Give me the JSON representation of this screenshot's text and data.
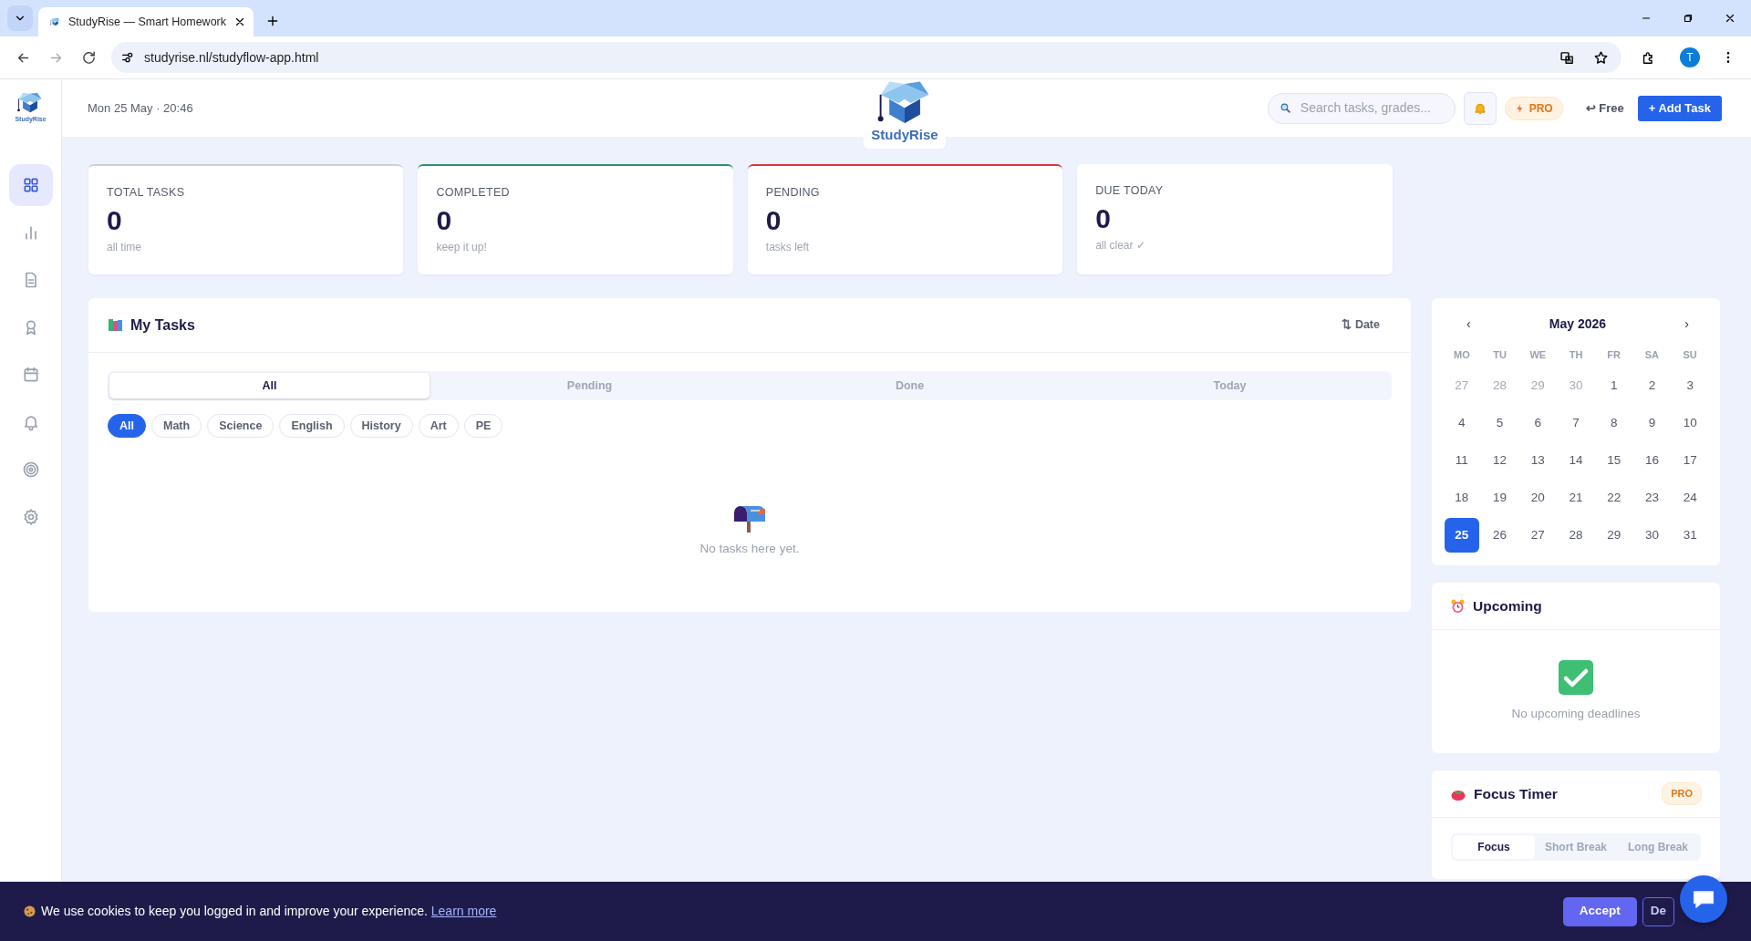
{
  "browser": {
    "tab_title": "StudyRise — Smart Homework",
    "url": "studyrise.nl/studyflow-app.html",
    "profile_initial": "T"
  },
  "sidebar": {
    "logo_text": "StudyRise",
    "items": [
      {
        "kind": "dashboard",
        "selected": true
      },
      {
        "kind": "chart",
        "selected": false
      },
      {
        "kind": "document",
        "selected": false
      },
      {
        "kind": "award",
        "selected": false
      },
      {
        "kind": "calendar",
        "selected": false
      },
      {
        "kind": "bell",
        "selected": false
      },
      {
        "kind": "target",
        "selected": false
      },
      {
        "kind": "settings",
        "selected": false
      }
    ]
  },
  "header": {
    "datetime": "Mon 25 May · 20:46",
    "logo_text": "StudyRise",
    "search": {
      "placeholder": "Search tasks, grades..."
    },
    "pro_badge": "PRO",
    "plan_link": "↩ Free",
    "add_button": "+ Add Task"
  },
  "stats": [
    {
      "label": "TOTAL TASKS",
      "value": "0",
      "caption": "all time",
      "color": "#cbd2dc"
    },
    {
      "label": "COMPLETED",
      "value": "0",
      "caption": "keep it up!",
      "color": "#2f8f6f"
    },
    {
      "label": "PENDING",
      "value": "0",
      "caption": "tasks left",
      "color": "#d9363e"
    },
    {
      "label": "DUE TODAY",
      "value": "0",
      "caption": "all clear ✓"
    }
  ],
  "tasks": {
    "title": "My Tasks",
    "sort": "⇅ Date",
    "tabs": [
      {
        "label": "All",
        "selected": true
      },
      {
        "label": "Pending",
        "selected": false
      },
      {
        "label": "Done",
        "selected": false
      },
      {
        "label": "Today",
        "selected": false
      }
    ],
    "filters": [
      {
        "label": "All",
        "selected": true
      },
      {
        "label": "Math",
        "selected": false
      },
      {
        "label": "Science",
        "selected": false
      },
      {
        "label": "English",
        "selected": false
      },
      {
        "label": "History",
        "selected": false
      },
      {
        "label": "Art",
        "selected": false
      },
      {
        "label": "PE",
        "selected": false
      }
    ],
    "empty_text": "No tasks here yet."
  },
  "calendar": {
    "prev": "‹",
    "month": "May 2026",
    "next": "›",
    "weekdays": [
      "MO",
      "TU",
      "WE",
      "TH",
      "FR",
      "SA",
      "SU"
    ],
    "days": [
      {
        "label": "27",
        "muted": true,
        "selected": false
      },
      {
        "label": "28",
        "muted": true,
        "selected": false
      },
      {
        "label": "29",
        "muted": true,
        "selected": false
      },
      {
        "label": "30",
        "muted": true,
        "selected": false
      },
      {
        "label": "1",
        "muted": false,
        "selected": false
      },
      {
        "label": "2",
        "muted": false,
        "selected": false
      },
      {
        "label": "3",
        "muted": false,
        "selected": false
      },
      {
        "label": "4",
        "muted": false,
        "selected": false
      },
      {
        "label": "5",
        "muted": false,
        "selected": false
      },
      {
        "label": "6",
        "muted": false,
        "selected": false
      },
      {
        "label": "7",
        "muted": false,
        "selected": false
      },
      {
        "label": "8",
        "muted": false,
        "selected": false
      },
      {
        "label": "9",
        "muted": false,
        "selected": false
      },
      {
        "label": "10",
        "muted": false,
        "selected": false
      },
      {
        "label": "11",
        "muted": false,
        "selected": false
      },
      {
        "label": "12",
        "muted": false,
        "selected": false
      },
      {
        "label": "13",
        "muted": false,
        "selected": false
      },
      {
        "label": "14",
        "muted": false,
        "selected": false
      },
      {
        "label": "15",
        "muted": false,
        "selected": false
      },
      {
        "label": "16",
        "muted": false,
        "selected": false
      },
      {
        "label": "17",
        "muted": false,
        "selected": false
      },
      {
        "label": "18",
        "muted": false,
        "selected": false
      },
      {
        "label": "19",
        "muted": false,
        "selected": false
      },
      {
        "label": "20",
        "muted": false,
        "selected": false
      },
      {
        "label": "21",
        "muted": false,
        "selected": false
      },
      {
        "label": "22",
        "muted": false,
        "selected": false
      },
      {
        "label": "23",
        "muted": false,
        "selected": false
      },
      {
        "label": "24",
        "muted": false,
        "selected": false
      },
      {
        "label": "25",
        "muted": false,
        "selected": true
      },
      {
        "label": "26",
        "muted": false,
        "selected": false
      },
      {
        "label": "27",
        "muted": false,
        "selected": false
      },
      {
        "label": "28",
        "muted": false,
        "selected": false
      },
      {
        "label": "29",
        "muted": false,
        "selected": false
      },
      {
        "label": "30",
        "muted": false,
        "selected": false
      },
      {
        "label": "31",
        "muted": false,
        "selected": false
      }
    ]
  },
  "upcoming": {
    "title": "Upcoming",
    "empty_text": "No upcoming deadlines"
  },
  "focus_timer": {
    "title": "Focus Timer",
    "badge": "PRO",
    "modes": [
      {
        "label": "Focus",
        "selected": true
      },
      {
        "label": "Short Break",
        "selected": false
      },
      {
        "label": "Long Break",
        "selected": false
      }
    ]
  },
  "cookie_banner": {
    "text": "We use cookies to keep you logged in and improve your experience.",
    "link": "Learn more",
    "accept": "Accept",
    "decline": "De"
  }
}
